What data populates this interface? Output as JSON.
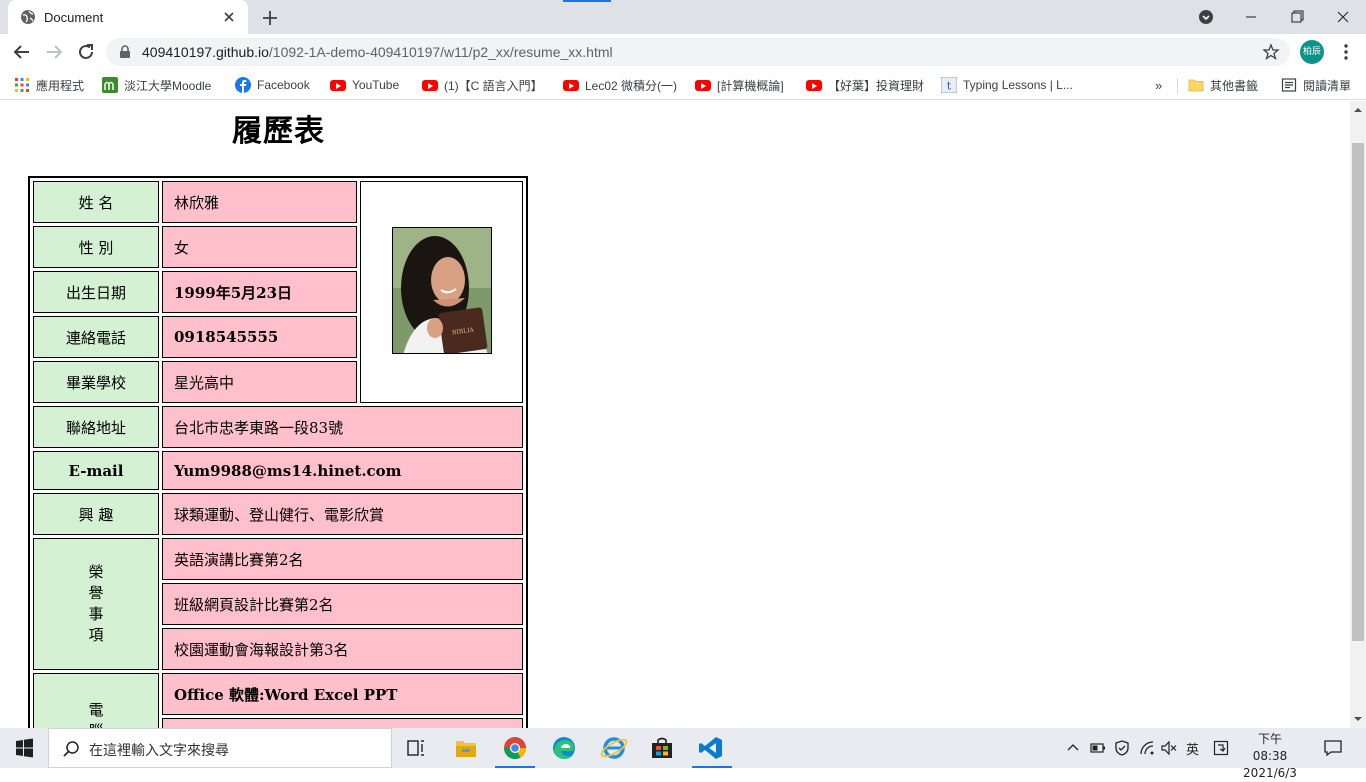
{
  "browser": {
    "tab_title": "Document",
    "url_host": "409410197.github.io",
    "url_path": "/1092-1A-demo-409410197/w11/p2_xx/resume_xx.html",
    "profile_label": "柏辰",
    "bookmarks": [
      {
        "label": "應用程式",
        "icon": "apps-grid-icon"
      },
      {
        "label": "淡江大學Moodle",
        "icon": "moodle-icon"
      },
      {
        "label": "Facebook",
        "icon": "facebook-icon"
      },
      {
        "label": "YouTube",
        "icon": "youtube-icon"
      },
      {
        "label": "(1)【C 語言入門】",
        "icon": "youtube-icon"
      },
      {
        "label": "Lec02 微積分(一)",
        "icon": "youtube-icon"
      },
      {
        "label": "[計算機概論]",
        "icon": "youtube-icon"
      },
      {
        "label": "【好葉】投資理財",
        "icon": "youtube-icon"
      },
      {
        "label": "Typing Lessons | L...",
        "icon": "typing-icon"
      }
    ],
    "more_bookmarks": "»",
    "other_bookmarks": "其他書籤",
    "reading_list": "閱讀清單"
  },
  "page": {
    "title": "履歷表",
    "rows": {
      "name_label": "姓 名",
      "name_value": "林欣雅",
      "gender_label": "性 別",
      "gender_value": "女",
      "birth_label": "出生日期",
      "birth_value": "1999年5月23日",
      "phone_label": "連絡電話",
      "phone_value": "0918545555",
      "school_label": "畢業學校",
      "school_value": "星光高中",
      "address_label": "聯絡地址",
      "address_value": "台北市忠孝東路一段83號",
      "email_label": "E-mail",
      "email_value": "Yum9988@ms14.hinet.com",
      "hobby_label": "興 趣",
      "hobby_value": "球類運動、登山健行、電影欣賞",
      "honor_label": [
        "榮",
        "譽",
        "事",
        "項"
      ],
      "honors": [
        "英語演講比賽第2名",
        "班級網頁設計比賽第2名",
        "校園運動會海報設計第3名"
      ],
      "computer_label": [
        "電",
        "腦"
      ],
      "computer_skills": [
        "Office 軟體:Word Excel PPT",
        ""
      ]
    }
  },
  "taskbar": {
    "search_placeholder": "在這裡輸入文字來搜尋",
    "ime": "英",
    "time": "下午 08:38",
    "date": "2021/6/3"
  },
  "colors": {
    "label_bg": "#d4f1d4",
    "value_bg": "#ffc0cb",
    "accent": "#1a73e8"
  }
}
